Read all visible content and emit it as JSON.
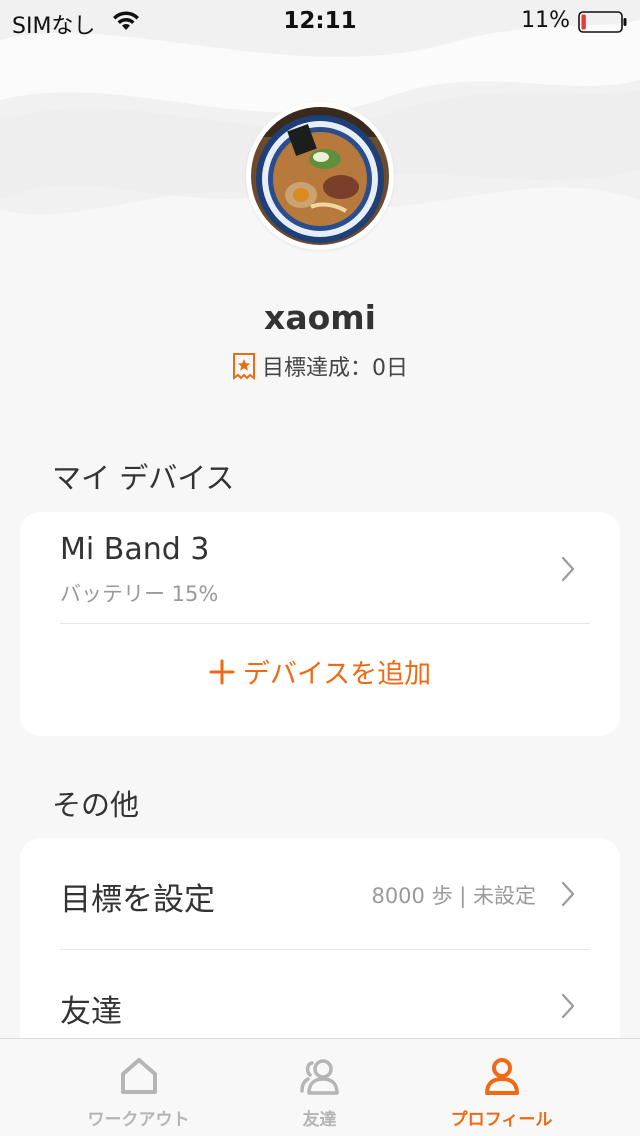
{
  "status_bar": {
    "carrier": "SIMなし",
    "time": "12:11",
    "battery_percent": "11%",
    "battery_level": 0.11,
    "icons": [
      "wifi-icon",
      "battery-icon"
    ]
  },
  "profile": {
    "username": "xaomi",
    "goal_streak_label": "目標達成：0日",
    "avatar_icon": "ramen-bowl-photo",
    "badge_icon": "star-badge-icon"
  },
  "devices_section": {
    "title": "マイ デバイス",
    "device": {
      "name": "Mi Band 3",
      "battery": "バッテリー 15%"
    },
    "add_device_label": "デバイスを追加",
    "add_icon": "plus-icon"
  },
  "others_section": {
    "title": "その他",
    "items": [
      {
        "label": "目標を設定",
        "value": "8000 歩 | 未設定"
      },
      {
        "label": "友達",
        "value": ""
      }
    ]
  },
  "tab_bar": {
    "tabs": [
      {
        "label": "ワークアウト",
        "icon": "home-icon",
        "active": false
      },
      {
        "label": "友達",
        "icon": "friends-icon",
        "active": false
      },
      {
        "label": "プロフィール",
        "icon": "profile-icon",
        "active": true
      }
    ]
  },
  "colors": {
    "accent": "#ef6a14",
    "battery_low": "#e53935",
    "background": "#f7f7f7",
    "card": "#ffffff",
    "secondary_text": "#9a9a9a"
  }
}
